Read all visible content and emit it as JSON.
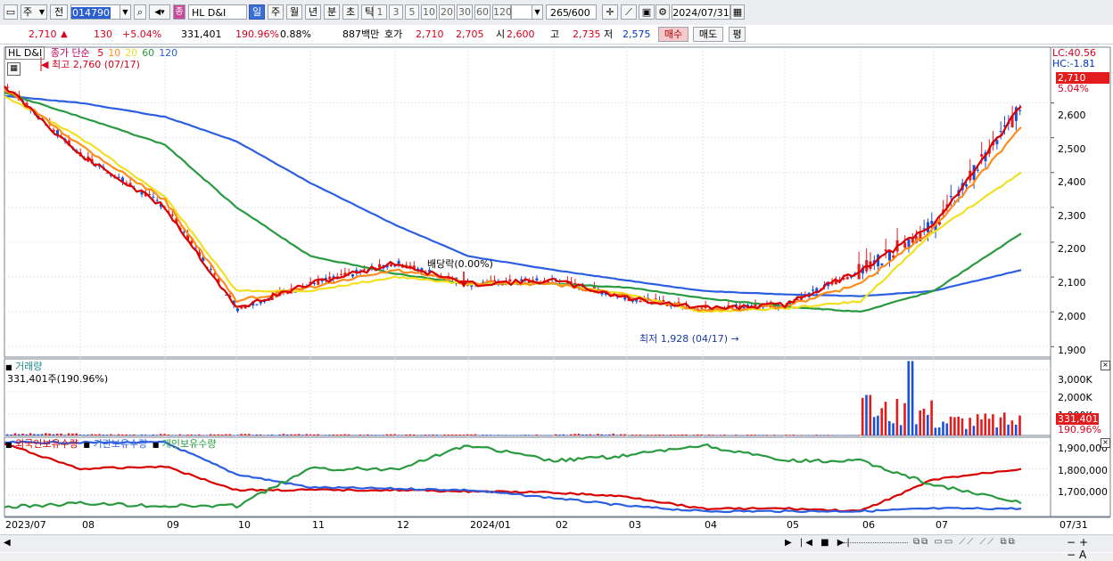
{
  "toolbar": {
    "period_btn": "주",
    "prev_btn": "전",
    "code": "014790",
    "type_badge": "종",
    "stock_name": "HL D&I",
    "period_tabs": [
      "일",
      "주",
      "월",
      "년",
      "분",
      "초",
      "틱"
    ],
    "interval_nums": [
      "1",
      "3",
      "5",
      "10",
      "20",
      "30",
      "60",
      "120"
    ],
    "count": "265",
    "count_total": "/600",
    "date": "2024/07/31"
  },
  "quote": {
    "price": "2,710",
    "up_arrow": "▲",
    "change": "130",
    "change_pct": "+5.04%",
    "volume": "331,401",
    "volume_ratio": "190.96%",
    "turnover_pct": "0.88%",
    "amount": "887백만",
    "hoga_label": "호가",
    "hoga_ask": "2,710",
    "hoga_bid": "2,705",
    "open_label": "시",
    "open": "2,600",
    "high_label": "고",
    "high": "2,735",
    "low_label": "저",
    "low": "2,575",
    "buy_btn": "매수",
    "sell_btn": "매도",
    "eval_btn": "평"
  },
  "price_panel": {
    "legend_name": "HL D&I",
    "ma_title": "종가 단순",
    "ma_periods": [
      "5",
      "10",
      "20",
      "60",
      "120"
    ],
    "ma_colors": [
      "#d80000",
      "#ff8c1a",
      "#f0e020",
      "#2a9a40",
      "#2c5fe0"
    ],
    "high_note": "최고 2,760 (07/17)",
    "low_note": "최저 1,928 (04/17)",
    "dividend_note": "배당락(0.00%)",
    "lc": "LC:40.56",
    "hc": "HC:-1.81",
    "last_price_tag": "2,710",
    "last_pct_tag": "5.04%",
    "y_labels": [
      "2,600",
      "2,500",
      "2,400",
      "2,300",
      "2,200",
      "2,100",
      "2,000",
      "1,900"
    ]
  },
  "volume_panel": {
    "title": "거래량",
    "info": "331,401주(190.96%)",
    "y_labels": [
      "3,000K",
      "2,000K",
      "1,000K"
    ],
    "last_tag": "331,401",
    "last_pct": "190.96%"
  },
  "holdings_panel": {
    "legend": [
      "외국인보유수량",
      "기관보유수량",
      "개인보유수량"
    ],
    "y_labels": [
      "1,900,000",
      "1,800,000",
      "1,700,000"
    ]
  },
  "x_axis": {
    "labels": [
      "2023/07",
      "08",
      "09",
      "10",
      "11",
      "12",
      "2024/01",
      "02",
      "03",
      "04",
      "05",
      "06",
      "07"
    ],
    "right_label": "07/31"
  },
  "chart_data": [
    {
      "type": "line",
      "title": "HL D&I",
      "x": [
        "2023/07",
        "08",
        "09",
        "10",
        "11",
        "12",
        "2024/01",
        "02",
        "03",
        "04",
        "05",
        "06",
        "07",
        "07/31"
      ],
      "series": [
        {
          "name": "5",
          "values": [
            2650,
            2450,
            2300,
            2010,
            2080,
            2140,
            2080,
            2090,
            2040,
            2010,
            2020,
            2120,
            2250,
            2590
          ]
        },
        {
          "name": "10",
          "values": [
            2640,
            2480,
            2320,
            2030,
            2070,
            2120,
            2085,
            2080,
            2045,
            2005,
            2015,
            2080,
            2240,
            2530
          ]
        },
        {
          "name": "20",
          "values": [
            2620,
            2500,
            2330,
            2060,
            2060,
            2100,
            2080,
            2080,
            2050,
            2000,
            2010,
            2030,
            2230,
            2400
          ]
        },
        {
          "name": "60",
          "values": [
            2630,
            2560,
            2480,
            2300,
            2160,
            2110,
            2080,
            2080,
            2070,
            2040,
            2015,
            2000,
            2060,
            2225
          ]
        },
        {
          "name": "120",
          "values": [
            2620,
            2600,
            2560,
            2490,
            2370,
            2250,
            2160,
            2120,
            2090,
            2060,
            2050,
            2045,
            2060,
            2120
          ]
        }
      ],
      "ylim": [
        1870,
        2760
      ]
    },
    {
      "type": "bar",
      "title": "거래량",
      "categories": [
        "2023/07",
        "08",
        "09",
        "10",
        "11",
        "12",
        "2024/01",
        "02",
        "03",
        "04",
        "05",
        "06",
        "07"
      ],
      "values": [
        90,
        60,
        50,
        60,
        50,
        45,
        50,
        70,
        40,
        35,
        30,
        1500,
        900
      ],
      "ylim": [
        0,
        3500
      ]
    },
    {
      "type": "line",
      "x": [
        "2023/07",
        "08",
        "09",
        "10",
        "11",
        "12",
        "2024/01",
        "02",
        "03",
        "04",
        "05",
        "06",
        "07",
        "07/31"
      ],
      "series": [
        {
          "name": "외국인보유수량",
          "values": [
            1895000,
            1800000,
            1810000,
            1720000,
            1720000,
            1720000,
            1715000,
            1710000,
            1695000,
            1650000,
            1650000,
            1640000,
            1760000,
            1800000
          ]
        },
        {
          "name": "기관보유수량",
          "values": [
            1900000,
            1900000,
            1900000,
            1780000,
            1730000,
            1725000,
            1720000,
            1690000,
            1660000,
            1640000,
            1640000,
            1640000,
            1650000,
            1650000
          ]
        },
        {
          "name": "개인보유수량",
          "values": [
            1655000,
            1670000,
            1660000,
            1660000,
            1800000,
            1800000,
            1890000,
            1830000,
            1850000,
            1890000,
            1830000,
            1830000,
            1740000,
            1670000
          ]
        }
      ],
      "ylim": [
        1620000,
        1920000
      ]
    }
  ]
}
